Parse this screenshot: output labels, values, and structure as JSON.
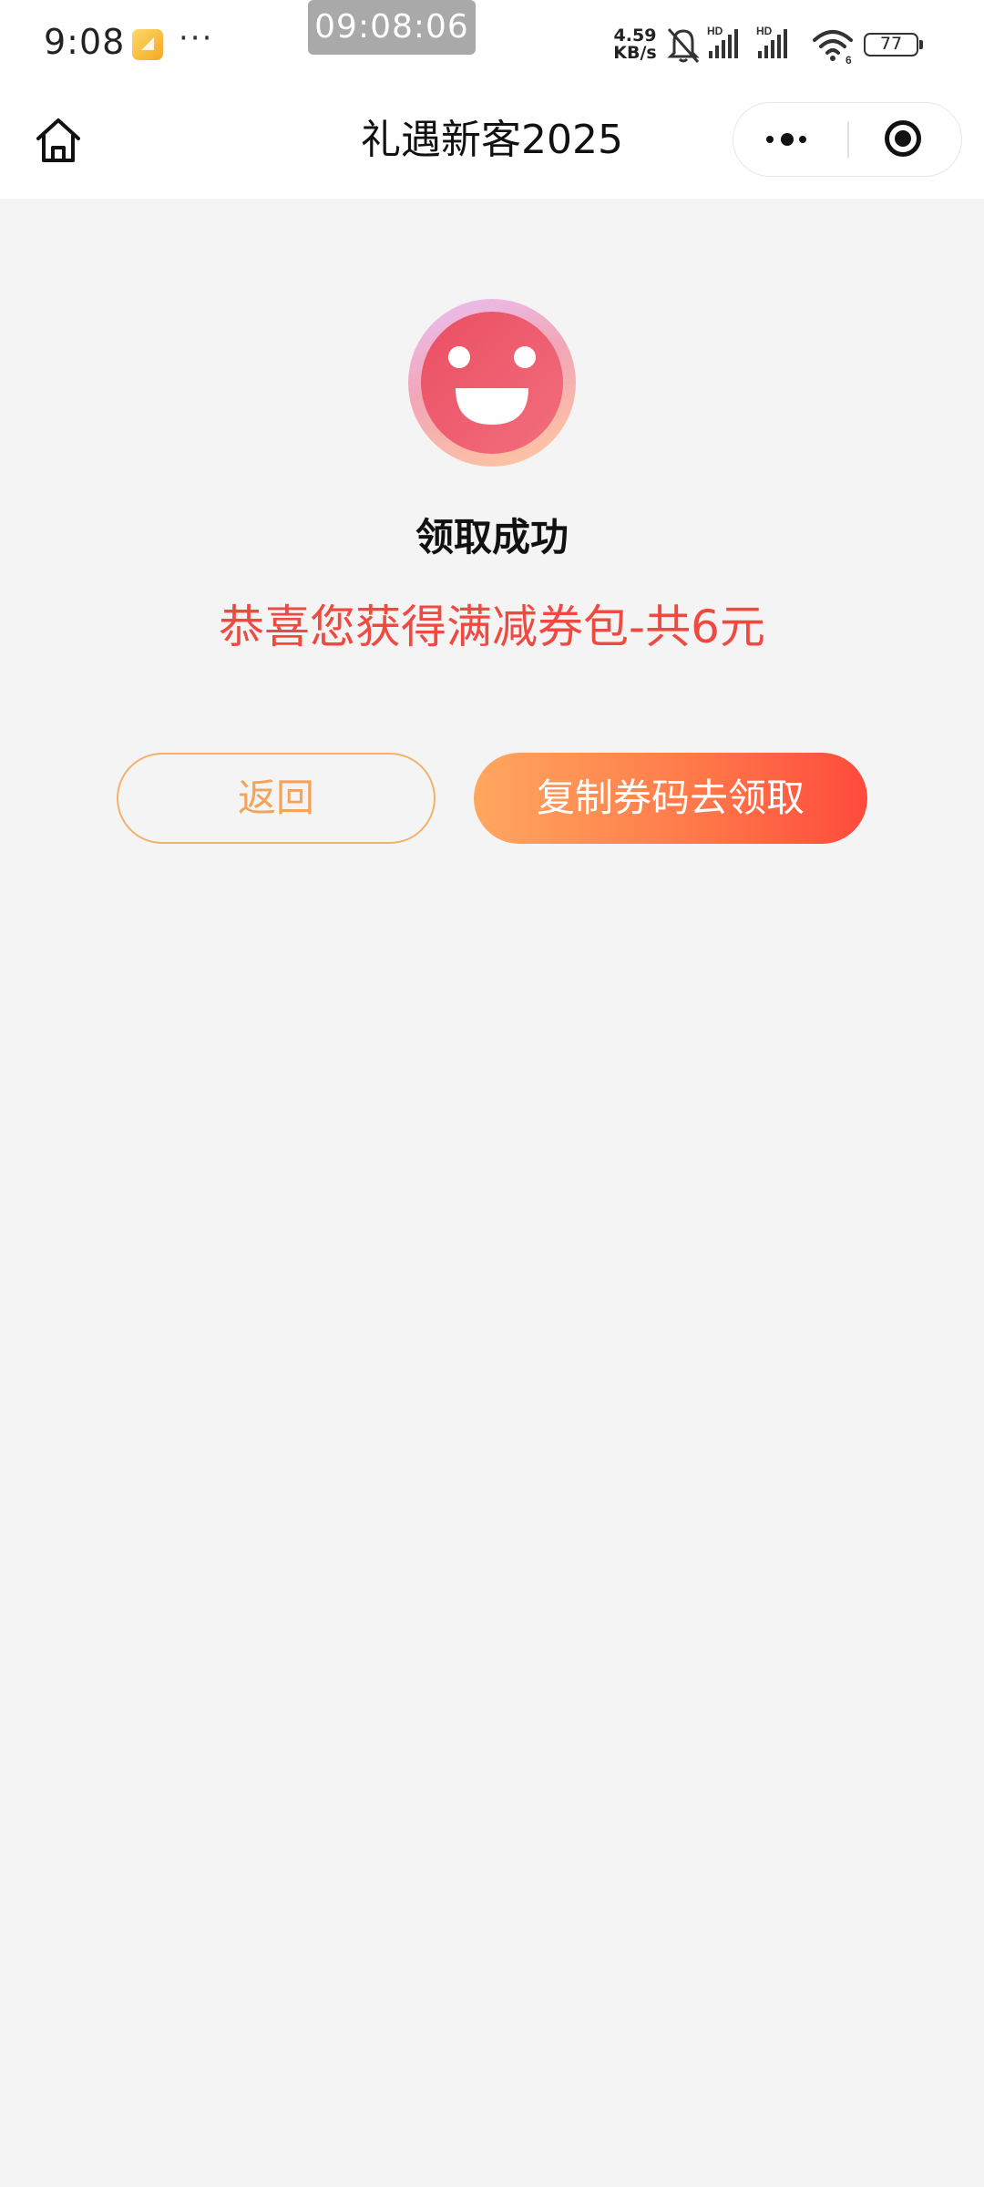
{
  "status_bar": {
    "time": "9:08",
    "notification_dots": "···",
    "clock_overlay": "09:08:06",
    "net_speed_value": "4.59",
    "net_speed_unit": "KB/s",
    "signal_1_label": "HD",
    "signal_2_label": "HD",
    "wifi_label": "6",
    "battery": "77",
    "icons": [
      "app-notification-icon",
      "mute-bell-icon",
      "signal-icon",
      "signal-icon",
      "wifi-icon",
      "battery-icon"
    ]
  },
  "nav": {
    "title": "礼遇新客2025",
    "home_icon": "home-icon",
    "more_icon": "more-dots-icon",
    "close_icon": "target-close-icon"
  },
  "content": {
    "icon": "smiley-face-icon",
    "title": "领取成功",
    "message": "恭喜您获得满减券包-共6元"
  },
  "buttons": {
    "back": "返回",
    "copy": "复制券码去领取"
  },
  "colors": {
    "background": "#f4f4f4",
    "message_red": "#ef4a41",
    "back_border": "#f3b26b",
    "copy_gradient_start": "#ffa75f",
    "copy_gradient_end": "#ff4a3d"
  }
}
